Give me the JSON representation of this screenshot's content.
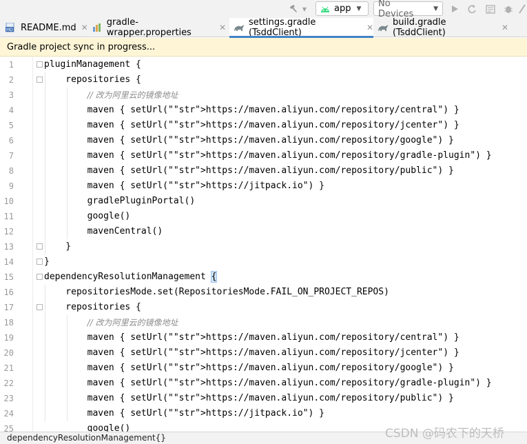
{
  "toolbar": {
    "run_config": "app",
    "device": "No Devices"
  },
  "tabs": [
    {
      "label": "README.md",
      "icon": "markdown-icon"
    },
    {
      "label": "gradle-wrapper.properties",
      "icon": "properties-icon"
    },
    {
      "label": "settings.gradle (TsddClient)",
      "icon": "gradle-icon",
      "active": true
    },
    {
      "label": "build.gradle (TsddClient)",
      "icon": "gradle-icon"
    }
  ],
  "banner": {
    "text": "Gradle project sync in progress..."
  },
  "code": {
    "line_numbers": [
      "1",
      "2",
      "3",
      "4",
      "5",
      "6",
      "7",
      "8",
      "9",
      "10",
      "11",
      "12",
      "13",
      "14",
      "15",
      "16",
      "17",
      "18",
      "19",
      "20",
      "21",
      "22",
      "23",
      "24",
      "25"
    ],
    "lines": [
      "pluginManagement {",
      "    repositories {",
      "        // 改为阿里云的镜像地址",
      "        maven { setUrl(\"https://maven.aliyun.com/repository/central\") }",
      "        maven { setUrl(\"https://maven.aliyun.com/repository/jcenter\") }",
      "        maven { setUrl(\"https://maven.aliyun.com/repository/google\") }",
      "        maven { setUrl(\"https://maven.aliyun.com/repository/gradle-plugin\") }",
      "        maven { setUrl(\"https://maven.aliyun.com/repository/public\") }",
      "        maven { setUrl(\"https://jitpack.io\") }",
      "        gradlePluginPortal()",
      "        google()",
      "        mavenCentral()",
      "    }",
      "}",
      "dependencyResolutionManagement {",
      "    repositoriesMode.set(RepositoriesMode.FAIL_ON_PROJECT_REPOS)",
      "    repositories {",
      "        // 改为阿里云的镜像地址",
      "        maven { setUrl(\"https://maven.aliyun.com/repository/central\") }",
      "        maven { setUrl(\"https://maven.aliyun.com/repository/jcenter\") }",
      "        maven { setUrl(\"https://maven.aliyun.com/repository/google\") }",
      "        maven { setUrl(\"https://maven.aliyun.com/repository/gradle-plugin\") }",
      "        maven { setUrl(\"https://maven.aliyun.com/repository/public\") }",
      "        maven { setUrl(\"https://jitpack.io\") }",
      "        google()"
    ]
  },
  "status": {
    "breadcrumb": "dependencyResolutionManagement{}"
  },
  "watermark": {
    "text": "CSDN @码农下的天桥"
  },
  "colors": {
    "string": "#067d17",
    "comment": "#8c8c8c",
    "accent": "#4083c9",
    "banner_bg": "#fdf5d6"
  }
}
